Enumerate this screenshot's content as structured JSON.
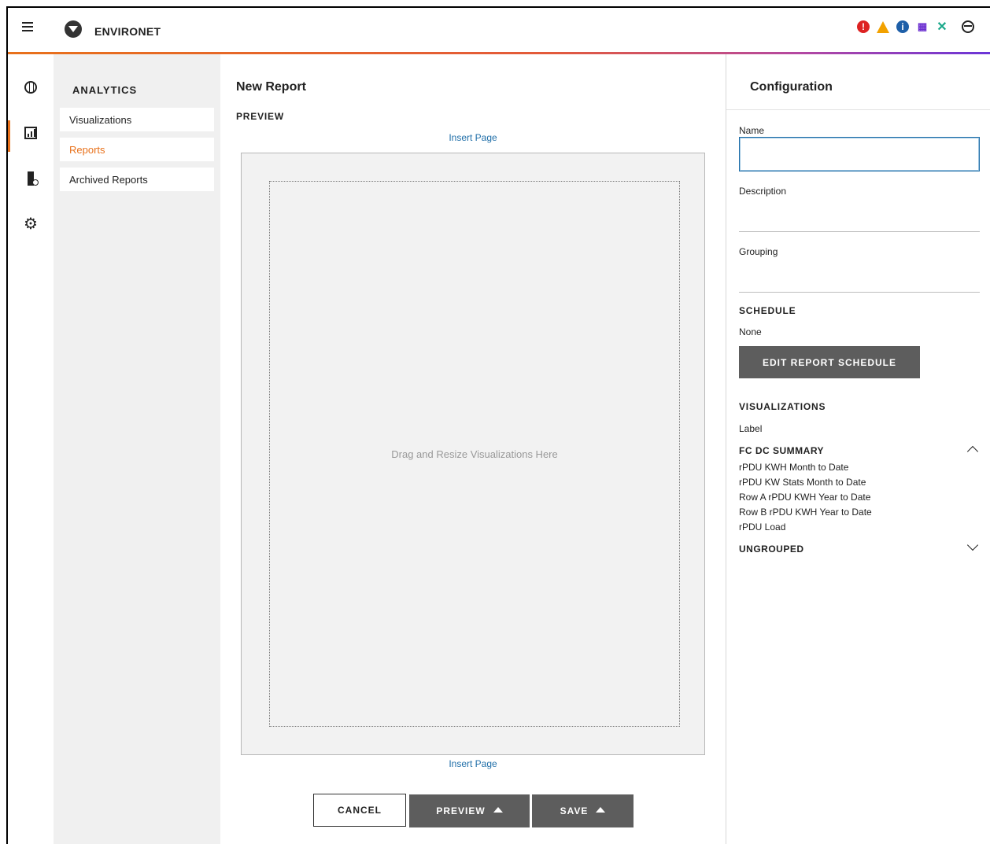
{
  "app": {
    "title": "ENVIRONET"
  },
  "status_icons": [
    "alarm-critical-icon",
    "warning-icon",
    "info-icon",
    "network-icon",
    "tools-icon",
    "user-icon"
  ],
  "colors": {
    "accent": "#e8711b",
    "link": "#1f6ea8",
    "dark_button": "#5d5d5d",
    "critical": "#dd2222",
    "warning": "#f2a100",
    "info": "#1e5fa8"
  },
  "rail": {
    "items": [
      "globe-icon",
      "analytics-chart-icon",
      "server-icon",
      "gear-icon"
    ],
    "active_index": 1
  },
  "sidebar": {
    "heading": "ANALYTICS",
    "items": [
      {
        "label": "Visualizations"
      },
      {
        "label": "Reports",
        "active": true
      },
      {
        "label": "Archived Reports"
      }
    ]
  },
  "main": {
    "title": "New Report",
    "preview_label": "PREVIEW",
    "insert_page_top": "Insert Page",
    "insert_page_bottom": "Insert Page",
    "dropzone_text": "Drag and Resize Visualizations Here",
    "buttons": {
      "cancel": "CANCEL",
      "preview": "PREVIEW",
      "save": "SAVE"
    }
  },
  "config": {
    "title": "Configuration",
    "name_label": "Name",
    "name_value": "",
    "description_label": "Description",
    "description_value": "",
    "grouping_label": "Grouping",
    "grouping_value": "",
    "schedule_heading": "SCHEDULE",
    "schedule_value": "None",
    "edit_schedule_button": "EDIT REPORT SCHEDULE",
    "visualizations_heading": "VISUALIZATIONS",
    "label_caption": "Label",
    "groups": [
      {
        "name": "FC DC SUMMARY",
        "expanded": true,
        "items": [
          "rPDU KWH Month to Date",
          "rPDU KW Stats Month to Date",
          "Row A rPDU KWH Year to Date",
          "Row B rPDU KWH Year to Date",
          "rPDU Load"
        ]
      },
      {
        "name": "UNGROUPED",
        "expanded": false,
        "items": []
      }
    ]
  }
}
